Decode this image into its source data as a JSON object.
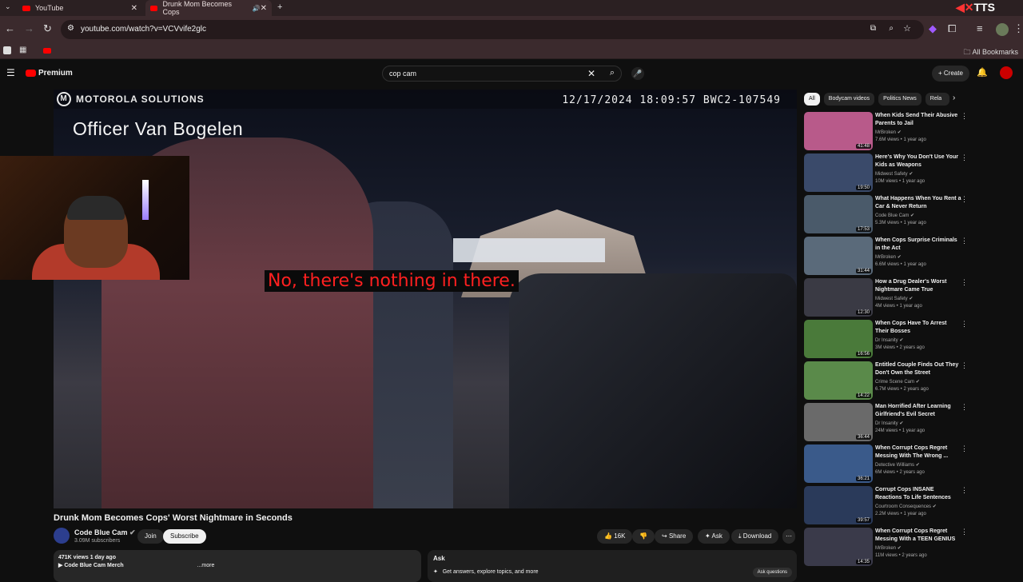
{
  "browser": {
    "tabs": [
      {
        "title": "YouTube"
      },
      {
        "title": "Drunk Mom Becomes Cops"
      }
    ],
    "url": "youtube.com/watch?v=VCVvife2glc",
    "bookmarks_label": "All Bookmarks",
    "extension_label": "TTS"
  },
  "header": {
    "logo": "Premium",
    "search_value": "cop cam",
    "create_label": "Create"
  },
  "video": {
    "brand": "MOTOROLA SOLUTIONS",
    "timestamp": "12/17/2024 18:09:57 BWC2-107549",
    "officer": "Officer Van Bogelen",
    "subtitle": "No, there's nothing in there."
  },
  "info": {
    "title": "Drunk Mom Becomes Cops' Worst Nightmare in Seconds",
    "channel": "Code Blue Cam",
    "subscribers": "3.09M subscribers",
    "join": "Join",
    "subscribe": "Subscribe",
    "likes": "16K",
    "share": "Share",
    "ask": "Ask",
    "download": "Download",
    "views": "471K views  1 day ago",
    "merch": "▶ Code Blue Cam Merch",
    "more": "...more",
    "ask_title": "Ask",
    "ask_prompt": "Get answers, explore topics, and more",
    "ask_button": "Ask questions"
  },
  "filters": [
    "All",
    "Bodycam videos",
    "Politics News",
    "Rela"
  ],
  "recommendations": [
    {
      "title": "When Kids Send Their Abusive Parents to Jail",
      "channel": "MrBroken",
      "meta": "7.6M views • 1 year ago",
      "duration": "41:48",
      "color": "#b85a8a"
    },
    {
      "title": "Here's Why You Don't Use Your Kids as Weapons",
      "channel": "Midwest Safety",
      "meta": "10M views • 1 year ago",
      "duration": "19:50",
      "color": "#3a4a6a"
    },
    {
      "title": "What Happens When You Rent a Car & Never Return",
      "channel": "Code Blue Cam",
      "meta": "5.3M views • 1 year ago",
      "duration": "17:53",
      "color": "#4a5a6a"
    },
    {
      "title": "When Cops Surprise Criminals in the Act",
      "channel": "MrBroken",
      "meta": "6.6M views • 1 year ago",
      "duration": "31:44",
      "color": "#5a6a7a"
    },
    {
      "title": "How a Drug Dealer's Worst Nightmare Came True",
      "channel": "Midwest Safety",
      "meta": "4M views • 1 year ago",
      "duration": "12:30",
      "color": "#3a3a44"
    },
    {
      "title": "When Cops Have To Arrest Their Bosses",
      "channel": "Dr Insanity",
      "meta": "3M views • 2 years ago",
      "duration": "16:56",
      "color": "#4a7a3a"
    },
    {
      "title": "Entitled Couple Finds Out They Don't Own the Street",
      "channel": "Crime Scene Cam",
      "meta": "6.7M views • 2 years ago",
      "duration": "14:22",
      "color": "#5a8a4a"
    },
    {
      "title": "Man Horrified After Learning Girlfriend's Evil Secret",
      "channel": "Dr Insanity",
      "meta": "24M views • 1 year ago",
      "duration": "36:44",
      "color": "#6a6a6a"
    },
    {
      "title": "When Corrupt Cops Regret Messing With The Wrong ...",
      "channel": "Detective Williams",
      "meta": "6M views • 2 years ago",
      "duration": "36:21",
      "color": "#3a5a8a"
    },
    {
      "title": "Corrupt Cops INSANE Reactions To Life Sentences",
      "channel": "Courtroom Consequences",
      "meta": "2.2M views • 1 year ago",
      "duration": "39:57",
      "color": "#2a3a5a"
    },
    {
      "title": "When Corrupt Cops Regret Messing With a TEEN GENIUS",
      "channel": "MrBroken",
      "meta": "11M views • 2 years ago",
      "duration": "14:35",
      "color": "#3a3a4a"
    }
  ]
}
